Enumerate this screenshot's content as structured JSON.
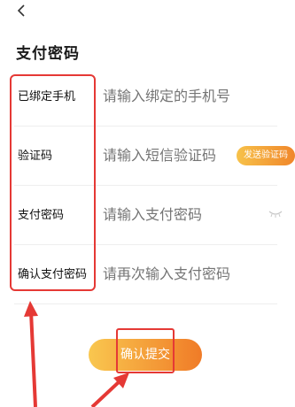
{
  "header": {
    "back_icon": "chevron-left-icon",
    "title": "支付密码"
  },
  "form": {
    "rows": [
      {
        "label": "已绑定手机",
        "placeholder": "请输入绑定的手机号"
      },
      {
        "label": "验证码",
        "placeholder": "请输入短信验证码",
        "action_label": "发送验证码"
      },
      {
        "label": "支付密码",
        "placeholder": "请输入支付密码",
        "icon": "eye-closed-icon"
      },
      {
        "label": "确认支付密码",
        "placeholder": "请再次输入支付密码"
      }
    ]
  },
  "confirm_button": {
    "label": "确认提交"
  },
  "colors": {
    "accent_start": "#f9c74f",
    "accent_end": "#f07b27",
    "annotation": "#e53935",
    "placeholder": "#c4c4c4"
  }
}
